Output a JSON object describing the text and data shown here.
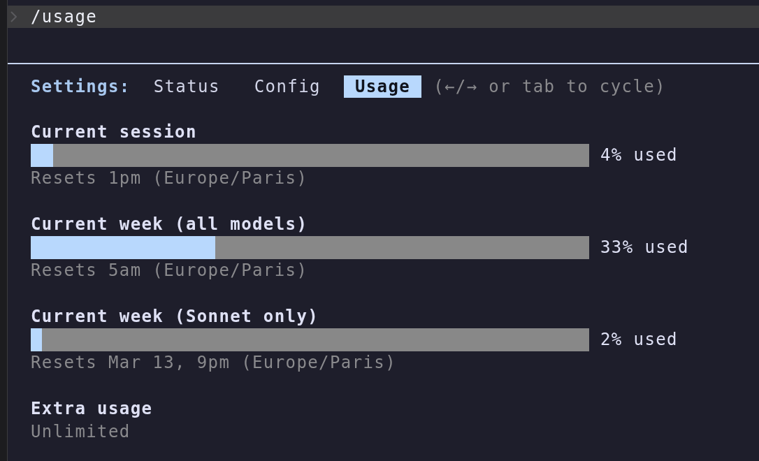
{
  "prompt": {
    "text": "/usage"
  },
  "settings": {
    "label": "Settings:",
    "tabs": [
      {
        "label": "Status",
        "selected": false
      },
      {
        "label": "Config",
        "selected": false
      },
      {
        "label": "Usage",
        "selected": true
      }
    ],
    "hint": "(←/→ or tab to cycle)"
  },
  "limits": [
    {
      "title": "Current session",
      "level": 0.04,
      "reading": "4% used",
      "reset": "Resets 1pm (Europe/Paris)"
    },
    {
      "title": "Current week (all models)",
      "level": 0.33,
      "reading": "33% used",
      "reset": "Resets 5am (Europe/Paris)"
    },
    {
      "title": "Current week (Sonnet only)",
      "level": 0.02,
      "reading": "2% used",
      "reset": "Resets Mar 13, 9pm (Europe/Paris)"
    }
  ],
  "extra_usage": {
    "title": "Extra usage",
    "value": "Unlimited"
  }
}
